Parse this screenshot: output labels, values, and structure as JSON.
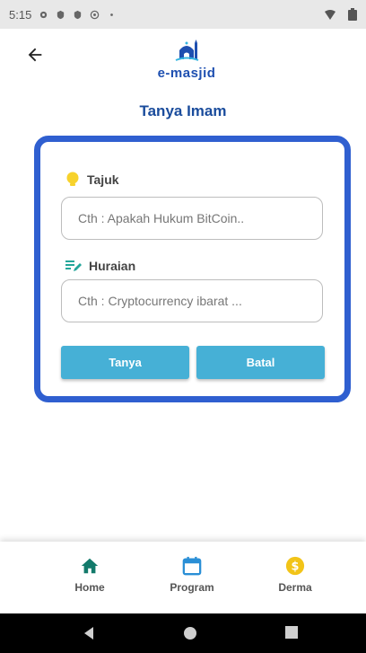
{
  "status_bar": {
    "time": "5:15"
  },
  "app": {
    "logo_text": "e-masjid"
  },
  "page": {
    "title": "Tanya Imam"
  },
  "form": {
    "tajuk_label": "Tajuk",
    "tajuk_placeholder": "Cth : Apakah Hukum BitCoin..",
    "huraian_label": "Huraian",
    "huraian_placeholder": "Cth : Cryptocurrency ibarat ...",
    "submit_label": "Tanya",
    "cancel_label": "Batal"
  },
  "bottom_nav": {
    "items": [
      {
        "label": "Home",
        "icon": "home-icon",
        "color": "#137a6b"
      },
      {
        "label": "Program",
        "icon": "calendar-icon",
        "color": "#2a8fd6"
      },
      {
        "label": "Derma",
        "icon": "dollar-coin-icon",
        "color": "#f2c418"
      }
    ]
  },
  "colors": {
    "accent": "#2f5fd0",
    "button": "#46b0d6",
    "title": "#1a4c9c",
    "bulb": "#f7d22c",
    "notes": "#23a69a"
  }
}
